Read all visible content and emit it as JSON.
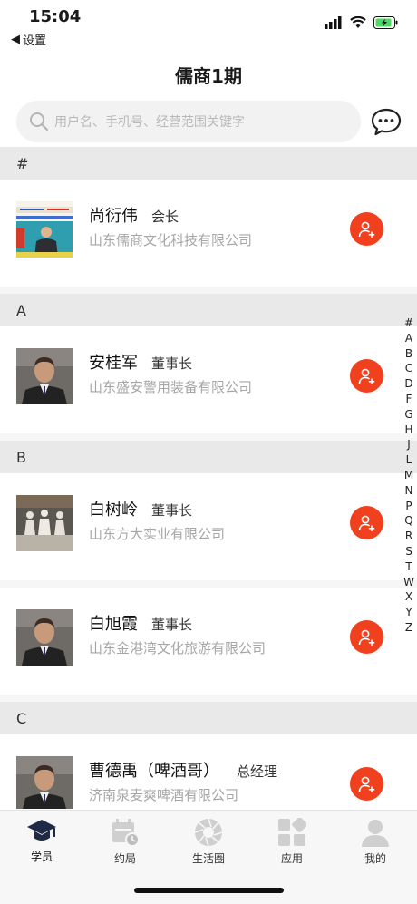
{
  "status": {
    "time": "15:04",
    "back_label": "设置"
  },
  "header": {
    "title": "儒商1期"
  },
  "search": {
    "placeholder": "用户名、手机号、经营范围关键字"
  },
  "sections": [
    {
      "letter": "#"
    },
    {
      "letter": "A"
    },
    {
      "letter": "B"
    },
    {
      "letter": "C"
    }
  ],
  "members": [
    {
      "name": "尚衍伟",
      "role": "会长",
      "company": "山东儒商文化科技有限公司",
      "avatar": "photo-banner-icon"
    },
    {
      "name": "安桂军",
      "role": "董事长",
      "company": "山东盛安警用装备有限公司",
      "avatar": "person-portrait-icon"
    },
    {
      "name": "白树岭",
      "role": "董事长",
      "company": "山东方大实业有限公司",
      "avatar": "statue-photo-icon"
    },
    {
      "name": "白旭霞",
      "role": "董事长",
      "company": "山东金港湾文化旅游有限公司",
      "avatar": "person-portrait-icon"
    },
    {
      "name": "曹德禹（啤酒哥）",
      "role": "总经理",
      "company": "济南泉麦爽啤酒有限公司",
      "avatar": "person-portrait-icon"
    }
  ],
  "index_letters": [
    "#",
    "A",
    "B",
    "C",
    "D",
    "F",
    "G",
    "H",
    "J",
    "L",
    "M",
    "N",
    "P",
    "Q",
    "R",
    "S",
    "T",
    "W",
    "X",
    "Y",
    "Z"
  ],
  "tabs": [
    {
      "label": "学员",
      "icon": "graduation-cap-icon",
      "active": true
    },
    {
      "label": "约局",
      "icon": "calendar-icon",
      "active": false
    },
    {
      "label": "生活圈",
      "icon": "aperture-icon",
      "active": false
    },
    {
      "label": "应用",
      "icon": "apps-grid-icon",
      "active": false
    },
    {
      "label": "我的",
      "icon": "user-icon",
      "active": false
    }
  ],
  "colors": {
    "accent": "#f0401d",
    "section_bg": "#e9e9e9",
    "placeholder": "#b8b8b8",
    "battery": "#4cd964"
  }
}
